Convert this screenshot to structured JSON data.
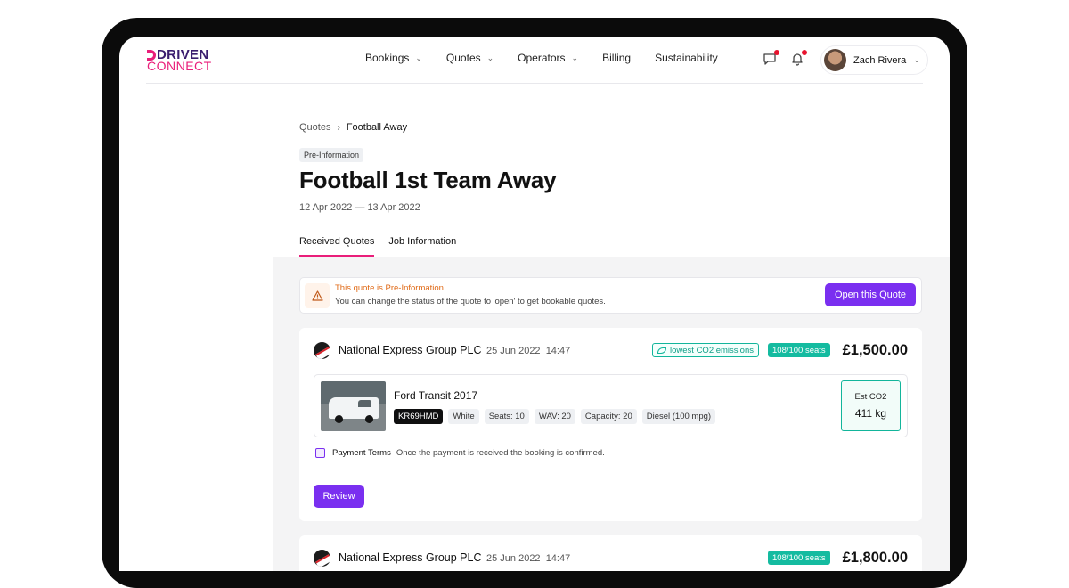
{
  "brand": {
    "line1": "DRIVEN",
    "line2": "CONNECT"
  },
  "nav": {
    "items": [
      {
        "label": "Bookings",
        "has_menu": true
      },
      {
        "label": "Quotes",
        "has_menu": true
      },
      {
        "label": "Operators",
        "has_menu": true
      },
      {
        "label": "Billing",
        "has_menu": false
      },
      {
        "label": "Sustainability",
        "has_menu": false
      }
    ],
    "user_name": "Zach Rivera",
    "notification_color": "#e8142f"
  },
  "breadcrumb": {
    "parent": "Quotes",
    "current": "Football Away"
  },
  "status_badge": "Pre-Information",
  "page_title": "Football 1st Team Away",
  "dates": "12 Apr 2022 — 13 Apr 2022",
  "tabs": [
    {
      "label": "Received Quotes",
      "active": true
    },
    {
      "label": "Job Information",
      "active": false
    }
  ],
  "alert": {
    "title": "This quote is Pre-Information",
    "message": "You can change the status of the quote to 'open' to get bookable quotes.",
    "button_label": "Open this Quote"
  },
  "quotes": [
    {
      "operator": "National Express Group PLC",
      "date": "25 Jun 2022",
      "time": "14:47",
      "eco_badge": "lowest CO2 emissions",
      "seats": "108/100 seats",
      "price": "£1,500.00",
      "vehicle": {
        "name": "Ford Transit 2017",
        "plate": "KR69HMD",
        "tags": [
          "White",
          "Seats: 10",
          "WAV: 20",
          "Capacity: 20",
          "Diesel (100 mpg)"
        ]
      },
      "co2_label": "Est CO2",
      "co2_value": "411 kg",
      "payment_label": "Payment Terms",
      "payment_text": "Once the payment is received the booking is confirmed.",
      "button_label": "Review"
    },
    {
      "operator": "National Express Group PLC",
      "date": "25 Jun 2022",
      "time": "14:47",
      "seats": "108/100 seats",
      "price": "£1,800.00"
    }
  ],
  "colors": {
    "accent": "#7a2ff0",
    "brand_pink": "#e91e7a",
    "eco_green": "#14bba0"
  }
}
